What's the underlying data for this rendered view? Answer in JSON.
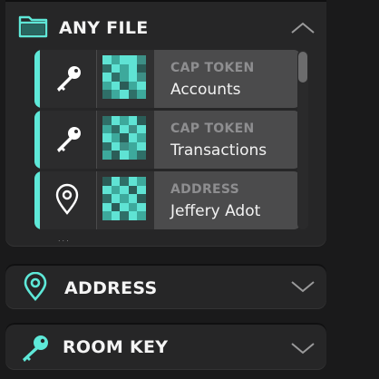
{
  "panels": {
    "any_file": {
      "title": "ANY FILE",
      "icon": "folder-icon",
      "expanded": true
    },
    "address": {
      "title": "ADDRESS",
      "icon": "location-pin-icon",
      "expanded": false
    },
    "room_key": {
      "title": "ROOM KEY",
      "icon": "key-icon",
      "expanded": false
    }
  },
  "items": [
    {
      "type": "CAP TOKEN",
      "name": "Accounts",
      "icon": "key-icon"
    },
    {
      "type": "CAP TOKEN",
      "name": "Transactions",
      "icon": "key-icon"
    },
    {
      "type": "ADDRESS",
      "name": "Jeffery Adot",
      "icon": "location-pin-icon"
    }
  ],
  "more_indicator": "...",
  "colors": {
    "accent": "#5ee8d8",
    "panel": "#262627",
    "background": "#1a1a1b",
    "row_info": "#4b4b4c",
    "type_text": "#8e8e90"
  },
  "thumbnails": [
    [
      "#5fe3d4",
      "#3da99c",
      "#5fe3d4",
      "#5fe3d4",
      "#3d8f86",
      "#2f6f68",
      "#5fe3d4",
      "#3da99c",
      "#5fe3d4",
      "#2b5d58",
      "#5fe3d4",
      "#2f6f68",
      "#3da99c",
      "#5fe3d4",
      "#3d8f86",
      "#3da99c",
      "#5fe3d4",
      "#2b5d58",
      "#3da99c",
      "#5fe3d4",
      "#2f6f68",
      "#3da99c",
      "#5fe3d4",
      "#2f6f68",
      "#3da99c"
    ],
    [
      "#2f6f68",
      "#5fe3d4",
      "#3da99c",
      "#5fe3d4",
      "#2b5d58",
      "#3da99c",
      "#2f6f68",
      "#5fe3d4",
      "#3d8f86",
      "#5fe3d4",
      "#5fe3d4",
      "#3da99c",
      "#2b5d58",
      "#5fe3d4",
      "#3da99c",
      "#2f6f68",
      "#5fe3d4",
      "#3d8f86",
      "#3da99c",
      "#5fe3d4",
      "#3da99c",
      "#2b5d58",
      "#5fe3d4",
      "#3da99c",
      "#2f6f68"
    ],
    [
      "#2b5d58",
      "#5fe3d4",
      "#2f6f68",
      "#5fe3d4",
      "#3da99c",
      "#5fe3d4",
      "#3da99c",
      "#5fe3d4",
      "#2b5d58",
      "#5fe3d4",
      "#2f6f68",
      "#5fe3d4",
      "#3da99c",
      "#5fe3d4",
      "#2b5d58",
      "#5fe3d4",
      "#2b5d58",
      "#5fe3d4",
      "#3da99c",
      "#5fe3d4",
      "#3da99c",
      "#5fe3d4",
      "#2f6f68",
      "#5fe3d4",
      "#3da99c"
    ]
  ]
}
